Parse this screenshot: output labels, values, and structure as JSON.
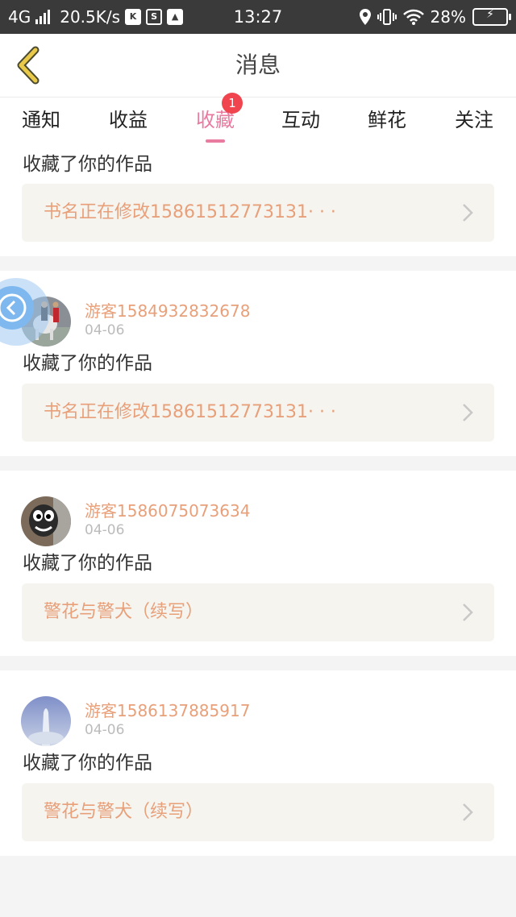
{
  "status_bar": {
    "network": "4G",
    "speed": "20.5K/s",
    "time": "13:27",
    "battery": "28%",
    "icons": [
      "signal-icon",
      "k-app-icon",
      "s-app-icon",
      "image-app-icon",
      "location-icon",
      "vibrate-icon",
      "wifi-icon",
      "battery-icon"
    ]
  },
  "nav": {
    "title": "消息",
    "back_icon": "chevron-left-icon"
  },
  "tabs": [
    {
      "label": "通知"
    },
    {
      "label": "收益"
    },
    {
      "label": "收藏",
      "active": true,
      "badge": "1"
    },
    {
      "label": "互动"
    },
    {
      "label": "鲜花"
    },
    {
      "label": "关注"
    }
  ],
  "items": [
    {
      "action": "收藏了你的作品",
      "work": "书名正在修改15861512773131· · ·"
    },
    {
      "user": "游客1584932832678",
      "date": "04-06",
      "action": "收藏了你的作品",
      "work": "书名正在修改15861512773131· · ·"
    },
    {
      "user": "游客1586075073634",
      "date": "04-06",
      "action": "收藏了你的作品",
      "work": "警花与警犬（续写）"
    },
    {
      "user": "游客1586137885917",
      "date": "04-06",
      "action": "收藏了你的作品",
      "work": "警花与警犬（续写）"
    }
  ],
  "colors": {
    "accent": "#e97aa0",
    "username": "#e8a07a",
    "badge": "#f0454f",
    "back_arrow": "#e9c94a"
  },
  "float_button_icon": "chevron-left-circle-icon"
}
